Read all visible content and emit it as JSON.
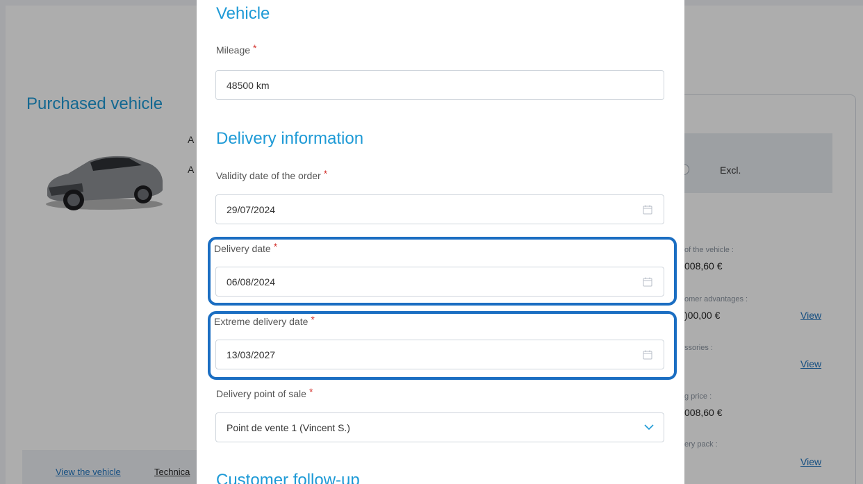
{
  "background": {
    "title": "Purchased vehicle",
    "car_fragment": "A",
    "excl_label": "Excl.",
    "price_vehicle_label": "of the vehicle :",
    "price_vehicle_value": "008,60 €",
    "customer_adv_label": "omer advantages :",
    "customer_adv_value": ")00,00 €",
    "accessories_label": "ssories :",
    "selling_price_label": "g price :",
    "selling_price_value": "008,60 €",
    "delivery_pack_label": "ery pack :",
    "view_link": "View",
    "footer": {
      "view_vehicle": "View the vehicle",
      "technical": "Technica"
    }
  },
  "modal": {
    "vehicle_section": "Vehicle",
    "mileage_label": "Mileage",
    "mileage_value": "48500 km",
    "delivery_section": "Delivery information",
    "validity_label": "Validity date of the order",
    "validity_value": "29/07/2024",
    "delivery_date_label": "Delivery date",
    "delivery_date_value": "06/08/2024",
    "extreme_label": "Extreme delivery date",
    "extreme_value": "13/03/2027",
    "point_of_sale_label": "Delivery point of sale",
    "point_of_sale_value": "Point de vente 1 (Vincent S.)",
    "followup_section": "Customer follow-up",
    "required_mark": "*"
  },
  "colors": {
    "accent": "#1e9ad6",
    "highlight": "#1b6ec2",
    "required": "#d3332e"
  },
  "icons": {
    "calendar": "calendar-icon",
    "chevron": "chevron-down-icon"
  }
}
